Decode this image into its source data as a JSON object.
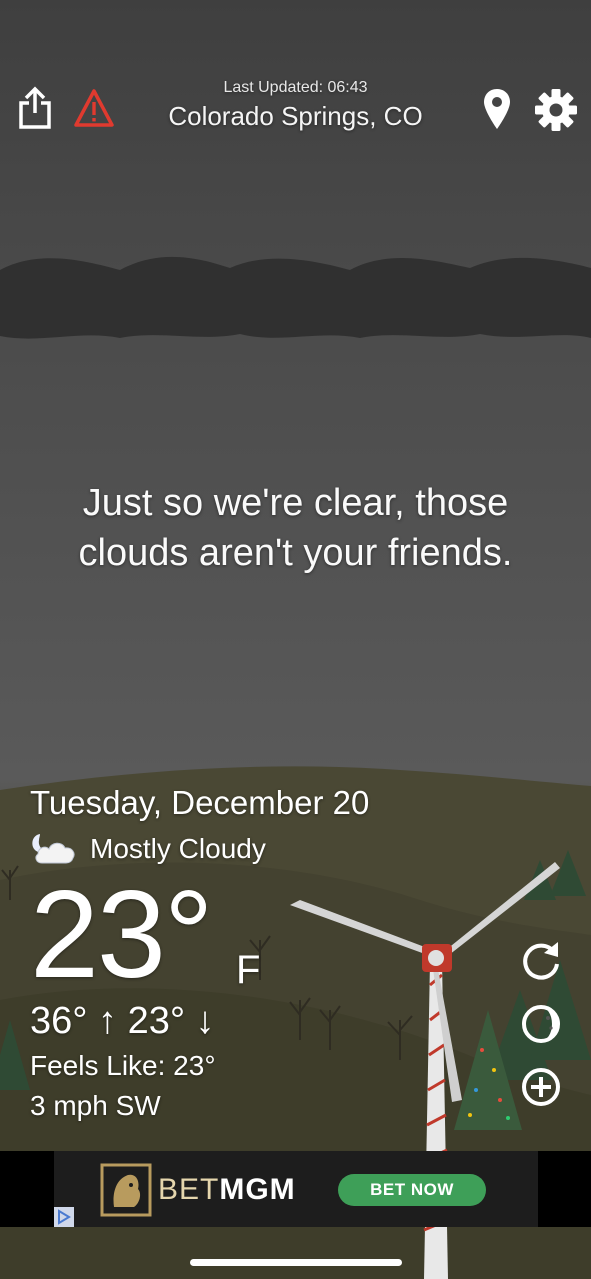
{
  "header": {
    "last_updated": "Last Updated: 06:43",
    "city": "Colorado Springs, CO"
  },
  "icons": {
    "share": "share-icon",
    "alert": "warning-triangle-icon",
    "location": "map-pin-icon",
    "settings": "gear-icon",
    "refresh": "refresh-icon",
    "moon": "moon-phase-icon",
    "add": "plus-circle-icon"
  },
  "quip": "Just so we're clear, those clouds aren't your friends.",
  "weather": {
    "date": "Tuesday, December 20",
    "condition": "Mostly Cloudy",
    "temperature": "23°",
    "unit": "F",
    "hi_lo": "36° ↑  23° ↓",
    "feels_like": "Feels Like: 23°",
    "wind": "3 mph SW"
  },
  "ad": {
    "brand_bet": "BET",
    "brand_mgm": "MGM",
    "cta": "BET NOW"
  },
  "colors": {
    "ad_cta": "#3e9f58",
    "alert_red": "#e03a2f",
    "turbine_hub": "#c0392b"
  }
}
